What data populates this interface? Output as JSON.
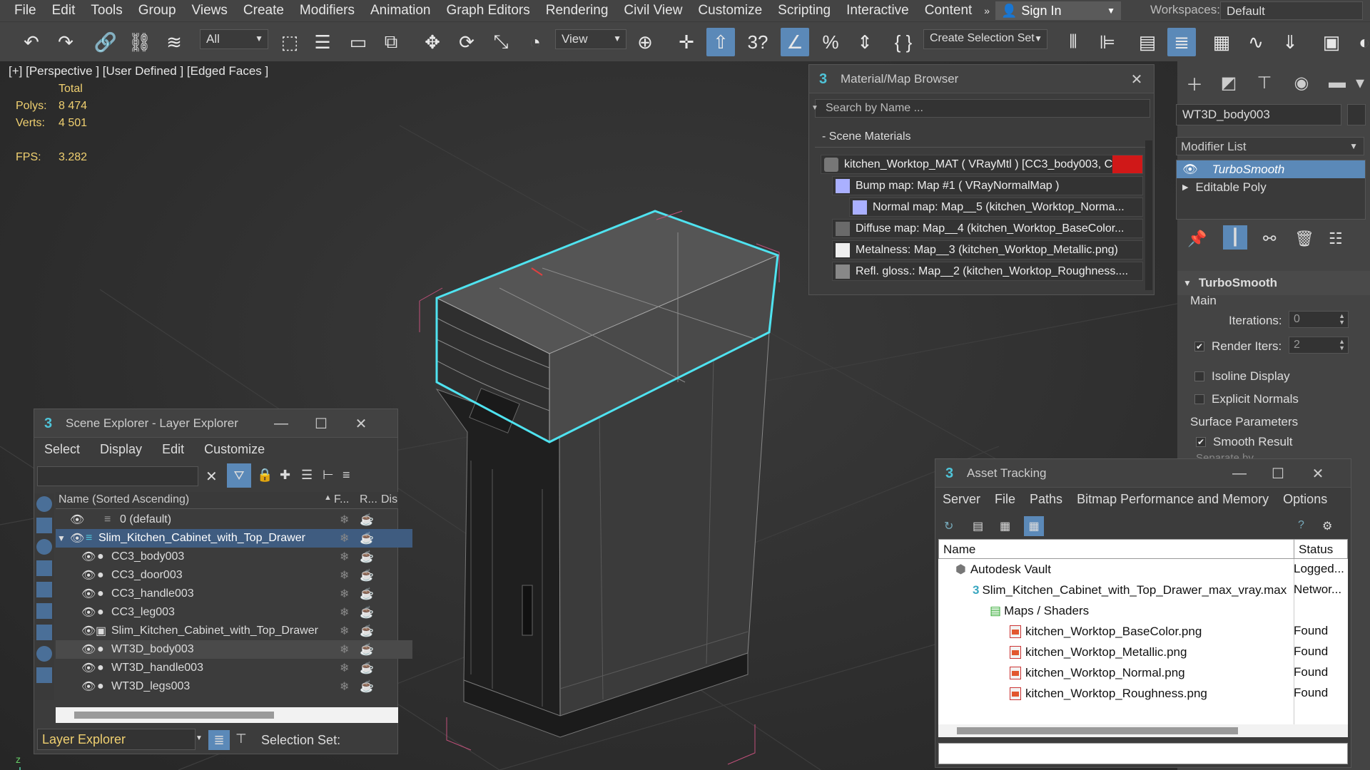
{
  "menu": [
    "File",
    "Edit",
    "Tools",
    "Group",
    "Views",
    "Create",
    "Modifiers",
    "Animation",
    "Graph Editors",
    "Rendering",
    "Civil View",
    "Customize",
    "Scripting",
    "Interactive",
    "Content"
  ],
  "menu_more": "»",
  "signin": "Sign In",
  "workspaces_label": "Workspaces:",
  "workspaces_value": "Default",
  "toolbar": {
    "filter_value": "All",
    "refcoord_value": "View",
    "selection_set": "Create Selection Set",
    "snap_count": "3"
  },
  "viewport": {
    "label": "[+] [Perspective ] [User Defined ] [Edged Faces ]",
    "stats_total": "Total",
    "polys_label": "Polys:",
    "polys_value": "8 474",
    "verts_label": "Verts:",
    "verts_value": "4 501",
    "fps_label": "FPS:",
    "fps_value": "3.282",
    "axis_z": "z",
    "axis_x": "x"
  },
  "material_browser": {
    "title": "Material/Map Browser",
    "search_placeholder": "Search by Name ...",
    "section": "- Scene Materials",
    "rows": [
      "kitchen_Worktop_MAT  ( VRayMtl )  [CC3_body003, C...",
      "Bump map: Map #1  ( VRayNormalMap )",
      "Normal  map: Map__5 (kitchen_Worktop_Norma...",
      "Diffuse  map: Map__4 (kitchen_Worktop_BaseColor...",
      "Metalness: Map__3 (kitchen_Worktop_Metallic.png)",
      "Refl.  gloss.: Map__2 (kitchen_Worktop_Roughness...."
    ]
  },
  "command_panel": {
    "object_name": "WT3D_body003",
    "modifier_list": "Modifier List",
    "stack": [
      "TurboSmooth",
      "Editable Poly"
    ],
    "rollout_title": "TurboSmooth",
    "main_label": "Main",
    "iterations_label": "Iterations:",
    "iterations_value": "0",
    "render_iters_label": "Render Iters:",
    "render_iters_value": "2",
    "isoline": "Isoline Display",
    "explicit": "Explicit Normals",
    "surface_params": "Surface Parameters",
    "smooth_result": "Smooth Result",
    "separate_by": "Separate by"
  },
  "scene_explorer": {
    "title": "Scene Explorer - Layer Explorer",
    "menus": [
      "Select",
      "Display",
      "Edit",
      "Customize"
    ],
    "col_name": "Name (Sorted Ascending)",
    "col_f": "F...",
    "col_r": "R...",
    "col_dis": "Dis",
    "rows": [
      {
        "name": "0 (default)",
        "level": 0
      },
      {
        "name": "Slim_Kitchen_Cabinet_with_Top_Drawer",
        "level": 0
      },
      {
        "name": "CC3_body003",
        "level": 1
      },
      {
        "name": "CC3_door003",
        "level": 1
      },
      {
        "name": "CC3_handle003",
        "level": 1
      },
      {
        "name": "CC3_leg003",
        "level": 1
      },
      {
        "name": "Slim_Kitchen_Cabinet_with_Top_Drawer",
        "level": 1
      },
      {
        "name": "WT3D_body003",
        "level": 1
      },
      {
        "name": "WT3D_handle003",
        "level": 1
      },
      {
        "name": "WT3D_legs003",
        "level": 1
      }
    ],
    "footer_combo": "Layer Explorer",
    "selection_set": "Selection Set:"
  },
  "asset_tracking": {
    "title": "Asset Tracking",
    "menus": [
      "Server",
      "File",
      "Paths",
      "Bitmap Performance and Memory",
      "Options"
    ],
    "col_name": "Name",
    "col_status": "Status",
    "rows": [
      {
        "name": "Autodesk Vault",
        "status": "Logged...",
        "indent": 0
      },
      {
        "name": "Slim_Kitchen_Cabinet_with_Top_Drawer_max_vray.max",
        "status": "Networ...",
        "indent": 1
      },
      {
        "name": "Maps / Shaders",
        "status": "",
        "indent": 2
      },
      {
        "name": "kitchen_Worktop_BaseColor.png",
        "status": "Found",
        "indent": 3
      },
      {
        "name": "kitchen_Worktop_Metallic.png",
        "status": "Found",
        "indent": 3
      },
      {
        "name": "kitchen_Worktop_Normal.png",
        "status": "Found",
        "indent": 3
      },
      {
        "name": "kitchen_Worktop_Roughness.png",
        "status": "Found",
        "indent": 3
      }
    ]
  },
  "colors": {
    "accent": "#5b89b8",
    "selection_outline": "#4fe3f0",
    "stats_text": "#f0d070"
  }
}
